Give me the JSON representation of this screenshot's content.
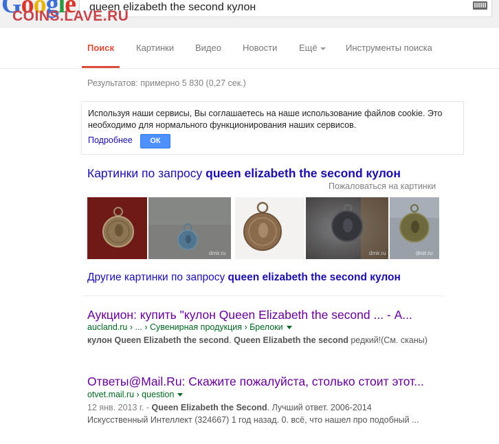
{
  "header": {
    "logo_parts": [
      "G",
      "o",
      "o",
      "g",
      "l",
      "e"
    ],
    "watermark": "COINS.LAVE.RU",
    "search_query": "queen elizabeth the second кулон",
    "keyboard_icon": "keyboard-icon"
  },
  "nav": {
    "tabs": [
      {
        "label": "Поиск",
        "active": true
      },
      {
        "label": "Картинки",
        "active": false
      },
      {
        "label": "Видео",
        "active": false
      },
      {
        "label": "Новости",
        "active": false
      },
      {
        "label": "Ещё",
        "active": false
      },
      {
        "label": "Инструменты поиска",
        "active": false
      }
    ]
  },
  "stats": "Результатов: примерно 5 830 (0,27 сек.)",
  "cookie": {
    "text": "Используя наши сервисы, Вы соглашаетесь на наше использование файлов cookie. Это необходимо для нормального функционирования наших сервисов.",
    "more_label": "Подробнее",
    "ok_label": "ОК"
  },
  "images": {
    "heading_prefix": "Картинки по запросу ",
    "heading_query": "queen elizabeth the second кулон",
    "report_label": "Пожаловаться на картинки",
    "thumbnails": [
      {
        "caption": ""
      },
      {
        "caption": "dmir.ru"
      },
      {
        "caption": ""
      },
      {
        "caption": "dmir.ru"
      },
      {
        "caption": "dmir.ru"
      }
    ],
    "more_prefix": "Другие картинки по запросу ",
    "more_query": "queen elizabeth the second кулон"
  },
  "results": [
    {
      "title": "Аукцион: купить \"кулон Queen Elizabeth the second ... - А...",
      "url": "aucland.ru › ... › Сувенирная продукция › Брелоки",
      "snippet_bold_1": "кулон Queen Elizabeth the second",
      "snippet_sep": ". ",
      "snippet_bold_2": "Queen Elizabeth the second",
      "snippet_rest": " редкий!(См. сканы)"
    },
    {
      "title": "Ответы@Mail.Ru: Скажите пожалуйста, столько стоит этот...",
      "url": "otvet.mail.ru › question",
      "date": "12 янв. 2013 г. - ",
      "snippet_bold_1": "Queen Elizabeth the Second",
      "snippet_rest_1": ". Лучший ответ. 2006-2014",
      "snippet_rest_2": "Искусственный Интеллект (324667) 1 год назад. 0. всё, что нашел про подобный ..."
    }
  ],
  "colors": {
    "link": "#1a0dab",
    "visited": "#660099",
    "url_green": "#006621",
    "accent_red": "#dd4b39",
    "button_blue": "#4d90fe"
  }
}
